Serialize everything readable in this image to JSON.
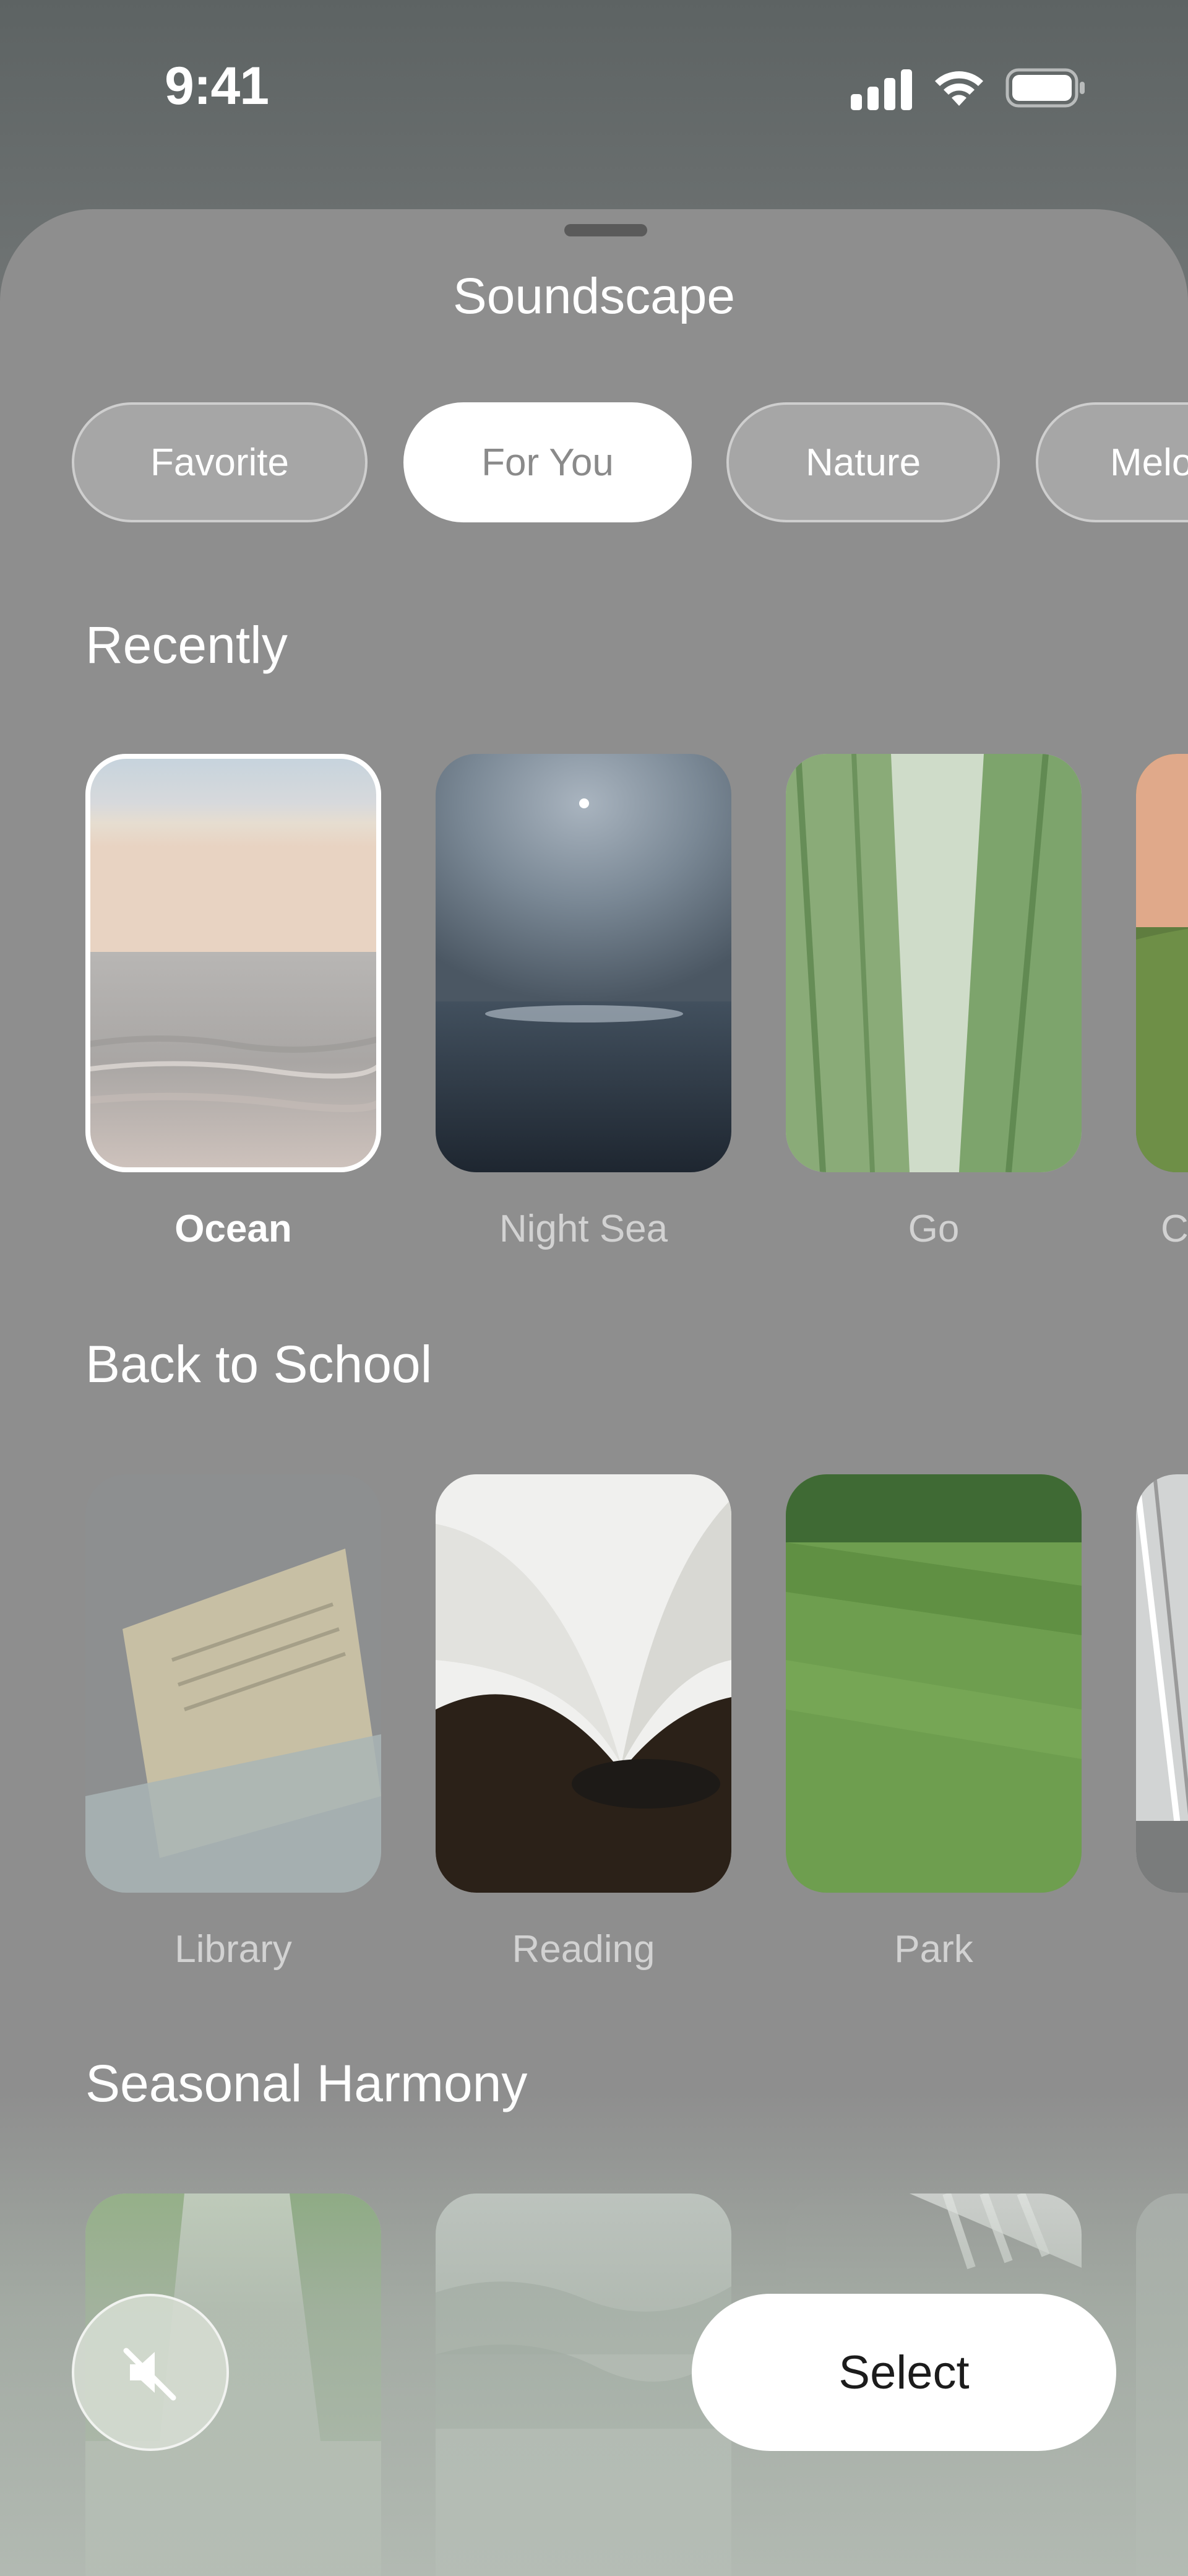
{
  "status_bar": {
    "time": "9:41",
    "icons": [
      "signal-icon",
      "wifi-icon",
      "battery-icon"
    ]
  },
  "sheet": {
    "title": "Soundscape"
  },
  "tabs": [
    {
      "label": "Favorite",
      "active": false
    },
    {
      "label": "For You",
      "active": true
    },
    {
      "label": "Nature",
      "active": false
    },
    {
      "label": "Melo",
      "active": false
    }
  ],
  "sections": [
    {
      "title": "Recently",
      "cards": [
        {
          "label": "Ocean",
          "selected": true
        },
        {
          "label": "Night Sea",
          "selected": false
        },
        {
          "label": "Go",
          "selected": false
        },
        {
          "label": "C",
          "selected": false
        }
      ]
    },
    {
      "title": "Back to School",
      "cards": [
        {
          "label": "Library",
          "selected": false
        },
        {
          "label": "Reading",
          "selected": false
        },
        {
          "label": "Park",
          "selected": false
        },
        {
          "label": "",
          "selected": false
        }
      ]
    },
    {
      "title": "Seasonal Harmony",
      "cards": [
        {
          "label": "",
          "selected": false
        },
        {
          "label": "",
          "selected": false
        },
        {
          "label": "",
          "selected": false
        },
        {
          "label": "",
          "selected": false
        }
      ]
    }
  ],
  "controls": {
    "mute_icon": "speaker-muted-icon",
    "select_label": "Select"
  },
  "colors": {
    "sheet_background": "#8e8e8e",
    "active_tab_background": "#ffffff",
    "active_tab_text": "#8a8a8a",
    "primary_button": "#ffffff"
  }
}
